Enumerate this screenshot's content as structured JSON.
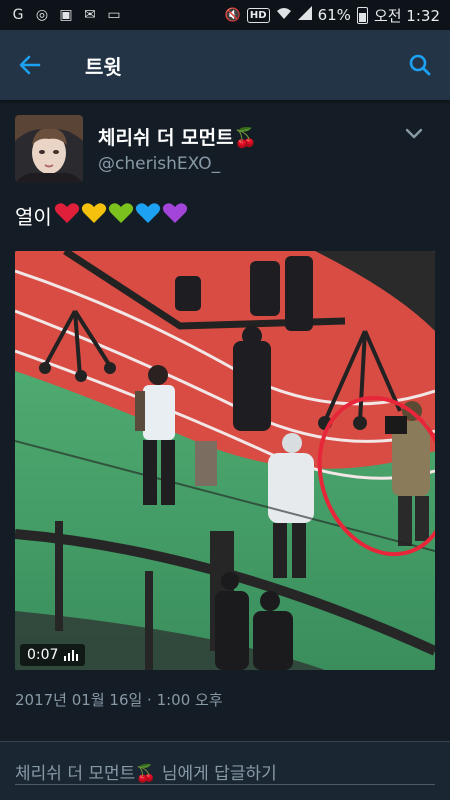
{
  "status_bar": {
    "battery": "61%",
    "time": "오전 1:32",
    "icons": [
      "g-icon",
      "c-icon",
      "gallery-icon",
      "chat-icon",
      "clipboard-icon",
      "mute-icon",
      "hd-icon",
      "wifi-icon",
      "signal-icon",
      "battery-icon"
    ],
    "hd_label": "HD"
  },
  "app_bar": {
    "title": "트윗",
    "back_icon": "arrow-left-icon",
    "search_icon": "search-icon"
  },
  "tweet": {
    "display_name": "체리쉬 더 모먼트",
    "name_emoji": "🍒",
    "username": "@cherishEXO_",
    "text": "열이",
    "hearts": [
      "#e0203a",
      "#f4c20d",
      "#7cc21e",
      "#1da1f2",
      "#a245d8"
    ],
    "media": {
      "duration": "0:07"
    },
    "timestamp": "2017년 01월 16일 · 1:00 오후"
  },
  "reply": {
    "prompt": "체리쉬 더 모먼트🍒 님에게 답글하기"
  },
  "colors": {
    "accent": "#1da1f2",
    "background": "#141d26",
    "appbar": "#243447",
    "secondary_text": "#8899a6"
  }
}
